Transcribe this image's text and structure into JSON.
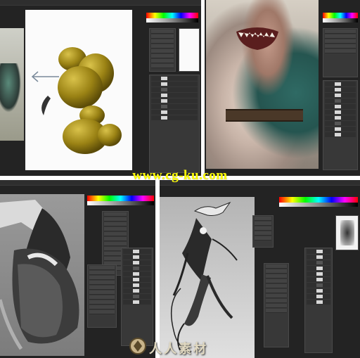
{
  "watermark": {
    "url_text": "www.cg-ku.com",
    "logo_text": "人人素材"
  },
  "panels": [
    {
      "id": "top-left",
      "subject": "sculpting blobs"
    },
    {
      "id": "top-right",
      "subject": "creature render"
    },
    {
      "id": "bottom-left",
      "subject": "grayscale sculpt"
    },
    {
      "id": "bottom-right",
      "subject": "creature sketch"
    }
  ],
  "colors": {
    "workspace": "#232323",
    "panel": "#383838",
    "blob": "#9a8214",
    "watermark": "#ffff00"
  },
  "icons": [
    "arrow-icon",
    "logo-icon"
  ]
}
